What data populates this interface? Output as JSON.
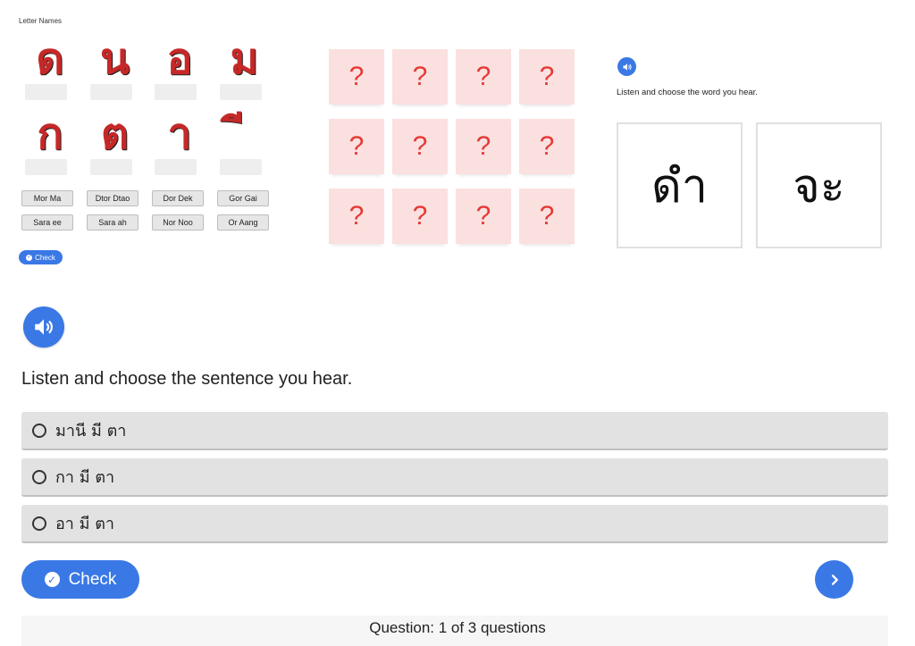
{
  "letter_names": {
    "title": "Letter Names",
    "letters_row1": [
      "ด",
      "น",
      "อ",
      "ม"
    ],
    "letters_row2": [
      "ก",
      "ต",
      "า",
      "ี"
    ],
    "names": [
      "Mor Ma",
      "Dtor Dtao",
      "Dor Dek",
      "Gor Gai",
      "Sara ee",
      "Sara ah",
      "Nor Noo",
      "Or Aang"
    ],
    "check_label": "Check"
  },
  "memory_game": {
    "cards": [
      "?",
      "?",
      "?",
      "?",
      "?",
      "?",
      "?",
      "?",
      "?",
      "?",
      "?",
      "?"
    ]
  },
  "word_quiz": {
    "prompt": "Listen and choose the word you hear.",
    "choices": [
      "ดำ",
      "จะ"
    ],
    "audio_icon": "speaker-icon"
  },
  "sentence_quiz": {
    "prompt": "Listen and choose the sentence you hear.",
    "options": [
      "มานี มี ตา",
      "กา มี ตา",
      "อา มี ตา"
    ],
    "check_label": "Check",
    "progress": "Question: 1 of 3 questions",
    "next_icon": "chevron-right-icon"
  },
  "colors": {
    "accent": "#3a78e6",
    "card_bg": "#fbe0e0",
    "card_text": "#e53935",
    "glyph": "#c62828"
  }
}
